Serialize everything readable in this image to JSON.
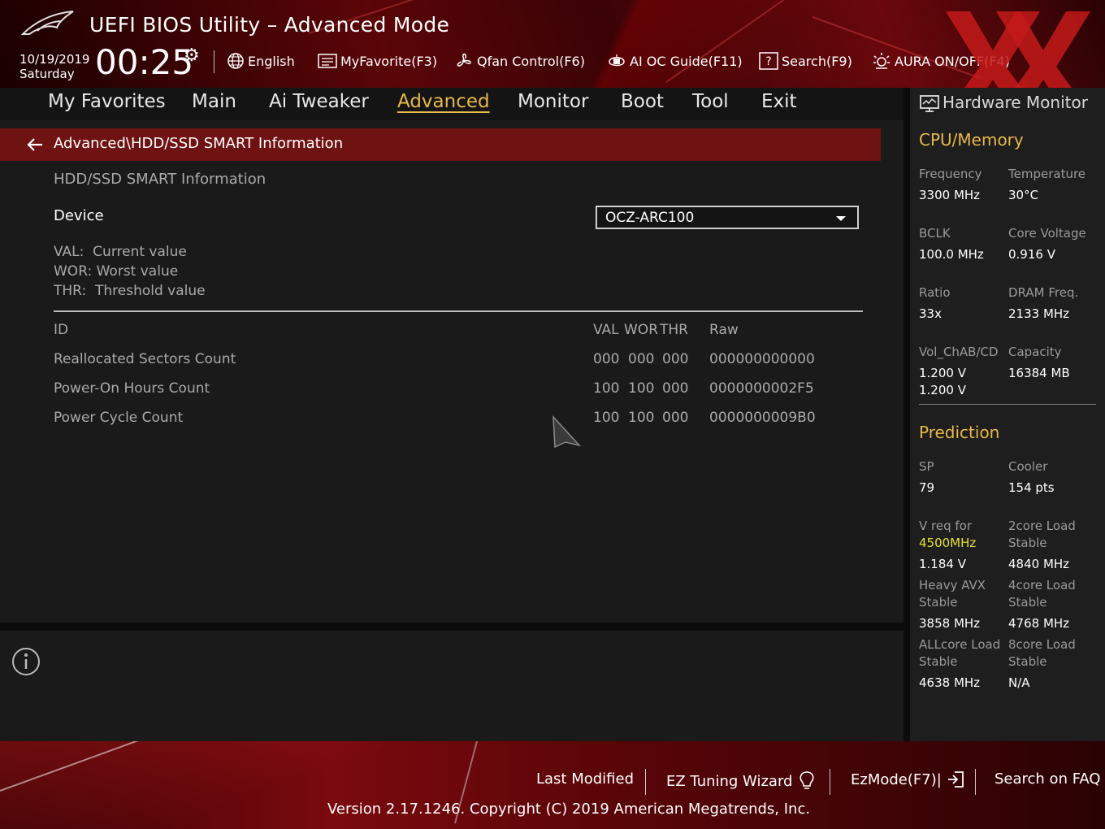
{
  "header": {
    "title": "UEFI BIOS Utility – Advanced Mode",
    "date": "10/19/2019",
    "day": "Saturday",
    "time": "00:25",
    "tools": [
      {
        "label": "English",
        "icon": "globe-icon"
      },
      {
        "label": "MyFavorite(F3)",
        "icon": "favorite-list-icon"
      },
      {
        "label": "Qfan Control(F6)",
        "icon": "fan-icon"
      },
      {
        "label": "AI OC Guide(F11)",
        "icon": "ai-chip-icon"
      },
      {
        "label": "Search(F9)",
        "icon": "help-search-icon"
      },
      {
        "label": "AURA ON/OFF(F4)",
        "icon": "aura-light-icon"
      }
    ]
  },
  "menu": {
    "items": [
      "My Favorites",
      "Main",
      "Ai Tweaker",
      "Advanced",
      "Monitor",
      "Boot",
      "Tool",
      "Exit"
    ],
    "active": "Advanced"
  },
  "main": {
    "breadcrumb": "Advanced\\HDD/SSD SMART Information",
    "section_title": "HDD/SSD SMART Information",
    "device_label": "Device",
    "device_value": "OCZ-ARC100",
    "legend": [
      "VAL:  Current value",
      "WOR: Worst value",
      "THR:  Threshold value"
    ],
    "table": {
      "headers": {
        "id": "ID",
        "val": "VAL",
        "wor": "WOR",
        "thr": "THR",
        "raw": "Raw"
      },
      "rows": [
        {
          "id": "Reallocated Sectors Count",
          "val": "000",
          "wor": "000",
          "thr": "000",
          "raw": "000000000000"
        },
        {
          "id": "Power-On Hours Count",
          "val": "100",
          "wor": "100",
          "thr": "000",
          "raw": "0000000002F5"
        },
        {
          "id": "Power Cycle Count",
          "val": "100",
          "wor": "100",
          "thr": "000",
          "raw": "0000000009B0"
        }
      ]
    }
  },
  "hardware_monitor": {
    "title": "Hardware Monitor",
    "cpu_memory": {
      "heading": "CPU/Memory",
      "frequency_label": "Frequency",
      "frequency": "3300 MHz",
      "temperature_label": "Temperature",
      "temperature": "30°C",
      "bclk_label": "BCLK",
      "bclk": "100.0 MHz",
      "core_voltage_label": "Core Voltage",
      "core_voltage": "0.916 V",
      "ratio_label": "Ratio",
      "ratio": "33x",
      "dram_freq_label": "DRAM Freq.",
      "dram_freq": "2133 MHz",
      "vol_label": "Vol_ChAB/CD",
      "vol_ab": "1.200 V",
      "vol_cd": "1.200 V",
      "capacity_label": "Capacity",
      "capacity": "16384 MB"
    },
    "prediction": {
      "heading": "Prediction",
      "sp_label": "SP",
      "sp": "79",
      "cooler_label": "Cooler",
      "cooler": "154 pts",
      "vreq_label": "V req for",
      "vreq_freq": "4500MHz",
      "vreq": "1.184 V",
      "load2_label_1": "2core Load",
      "load2_label_2": "Stable",
      "load2": "4840 MHz",
      "avx_label_1": "Heavy AVX",
      "avx_label_2": "Stable",
      "avx": "3858 MHz",
      "load4_label_1": "4core Load",
      "load4_label_2": "Stable",
      "load4": "4768 MHz",
      "allcore_label_1": "ALLcore Load",
      "allcore_label_2": "Stable",
      "allcore": "4638 MHz",
      "load8_label_1": "8core Load",
      "load8_label_2": "Stable",
      "load8": "N/A"
    }
  },
  "footer": {
    "last_modified": "Last Modified",
    "ez_tuning": "EZ Tuning Wizard",
    "ez_mode": "EzMode(F7)|",
    "search_faq": "Search on FAQ",
    "version": "Version 2.17.1246. Copyright (C) 2019 American Megatrends, Inc."
  }
}
